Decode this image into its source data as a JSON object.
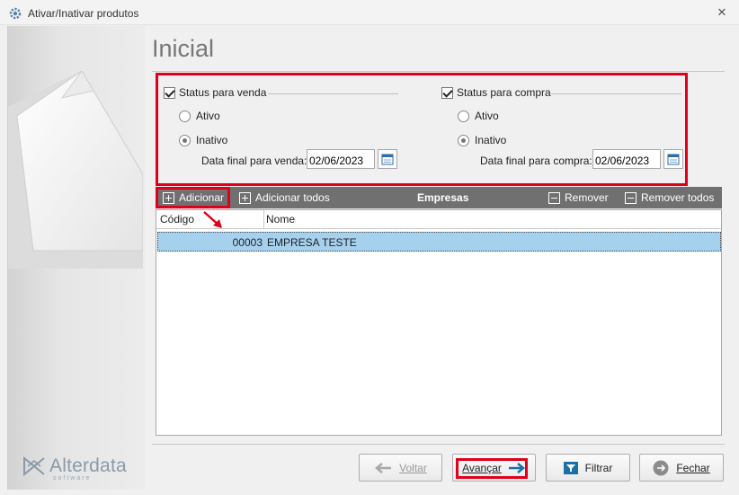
{
  "window": {
    "title": "Ativar/Inativar produtos",
    "close_symbol": "✕"
  },
  "sidebar": {
    "logo_name": "Alterdata",
    "logo_sub": "software"
  },
  "page": {
    "title": "Inicial"
  },
  "status_venda": {
    "checkbox_label": "Status para venda",
    "checked": true,
    "option_ativo": "Ativo",
    "option_inativo": "Inativo",
    "selected": "Inativo",
    "date_label": "Data final para venda:",
    "date_value": "02/06/2023"
  },
  "status_compra": {
    "checkbox_label": "Status para compra",
    "checked": true,
    "option_ativo": "Ativo",
    "option_inativo": "Inativo",
    "selected": "Inativo",
    "date_label": "Data final para compra:",
    "date_value": "02/06/2023"
  },
  "toolbar": {
    "add_label": "Adicionar",
    "add_all_label": "Adicionar todos",
    "title": "Empresas",
    "remove_label": "Remover",
    "remove_all_label": "Remover todos"
  },
  "grid": {
    "columns": [
      "Código",
      "Nome"
    ],
    "rows": [
      {
        "codigo": "00003",
        "nome": "EMPRESA TESTE"
      }
    ]
  },
  "footer": {
    "back_label": "Voltar",
    "next_label": "Avançar",
    "filter_label": "Filtrar",
    "close_label": "Fechar"
  },
  "colors": {
    "annotation_red": "#e0001b",
    "selection_blue": "#a6d1ee",
    "toolbar_gray": "#707070"
  },
  "icons": [
    "gear-icon",
    "close-icon",
    "calendar-icon",
    "plus-box-icon",
    "minus-box-icon",
    "arrow-left-icon",
    "arrow-right-icon",
    "filter-icon",
    "exit-icon"
  ]
}
